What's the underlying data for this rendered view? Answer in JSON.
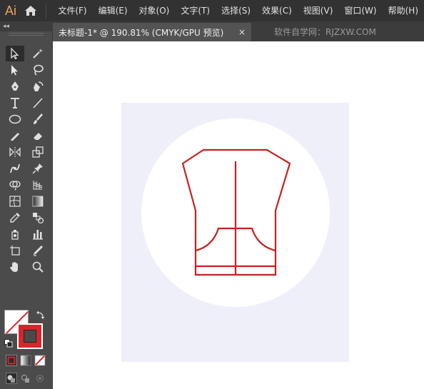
{
  "app": {
    "logo": "Ai",
    "home_icon": "home-icon"
  },
  "menu": {
    "items": [
      "文件(F)",
      "编辑(E)",
      "对象(O)",
      "文字(T)",
      "选择(S)",
      "效果(C)",
      "视图(V)",
      "窗口(W)",
      "帮助(H)"
    ]
  },
  "document": {
    "tab_title": "未标题-1* @ 190.81% (CMYK/GPU 预览)",
    "close_glyph": "×",
    "watermark": "软件自学网：RJZXW.COM"
  },
  "toolbox": {
    "collapse_glyph": "◂◂",
    "tools": [
      "selection-tool",
      "magic-wand-tool",
      "direct-selection-tool",
      "lasso-tool",
      "pen-tool",
      "curvature-tool",
      "type-tool",
      "line-segment-tool",
      "ellipse-tool",
      "paintbrush-tool",
      "shaper-tool",
      "eraser-tool",
      "reflect-tool",
      "scale-tool",
      "puppet-warp-tool",
      "pin-tool",
      "shape-builder-tool",
      "perspective-grid-tool",
      "mesh-tool",
      "gradient-tool",
      "eyedropper-tool",
      "blend-tool",
      "symbol-sprayer-tool",
      "column-graph-tool",
      "artboard-tool",
      "slice-tool",
      "hand-tool",
      "zoom-tool"
    ]
  },
  "colors": {
    "fill": "#ffffff",
    "stroke": "#d6262b",
    "artboard_bg": "#efeff9",
    "illustration_stroke": "#c8201f"
  }
}
